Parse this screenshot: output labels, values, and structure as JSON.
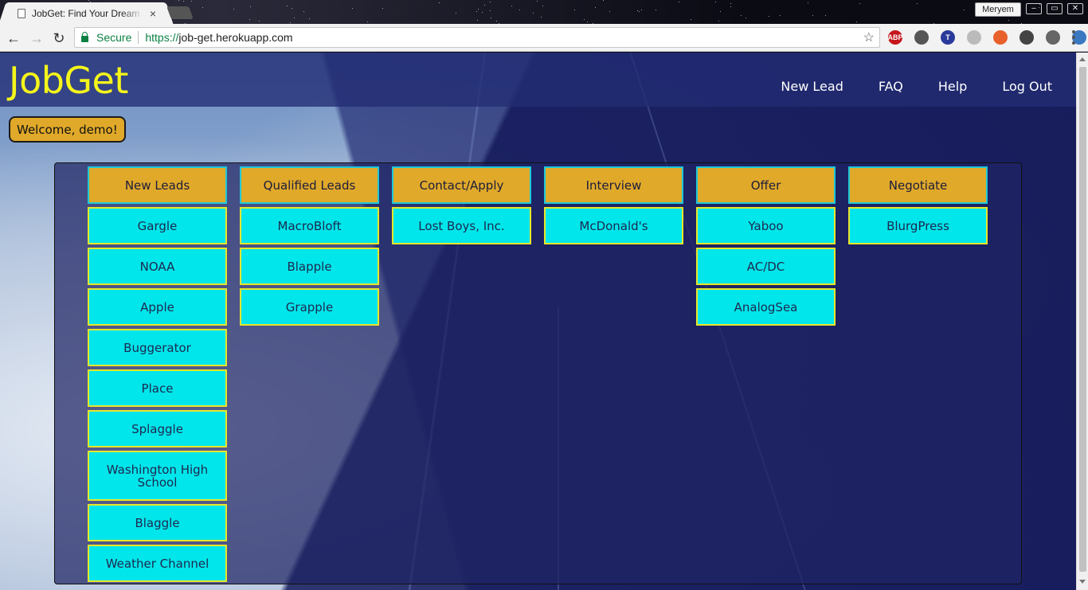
{
  "browser": {
    "tab_title": "JobGet: Find Your Dream Job",
    "tab_close": "×",
    "profile_name": "Meryem",
    "secure_label": "Secure",
    "url_scheme": "https://",
    "url_host": "job-get.herokuapp.com",
    "icons": {
      "back": "arrow-left-icon",
      "forward": "arrow-right-icon",
      "reload": "reload-icon",
      "bookmark": "star-icon",
      "menu": "menu-dots-icon"
    },
    "extensions": [
      {
        "name": "adblock-icon",
        "label": "ABP",
        "color": "#c4161c"
      },
      {
        "name": "pen-extension-icon",
        "label": "",
        "color": "#555555"
      },
      {
        "name": "t-extension-icon",
        "label": "T",
        "color": "#2a3a9a"
      },
      {
        "name": "circle-extension-icon",
        "label": "",
        "color": "#bbbbbb"
      },
      {
        "name": "orange-extension-icon",
        "label": "",
        "color": "#e8602c"
      },
      {
        "name": "react-extension-icon",
        "label": "",
        "color": "#444444"
      },
      {
        "name": "gear-extension-icon",
        "label": "",
        "color": "#666666"
      },
      {
        "name": "owl-extension-icon",
        "label": "",
        "color": "#3b78c2"
      }
    ]
  },
  "navbar": {
    "brand": "JobGet",
    "links": [
      "New Lead",
      "FAQ",
      "Help",
      "Log Out"
    ]
  },
  "welcome": "Welcome, demo!",
  "board": {
    "columns": [
      {
        "title": "New Leads",
        "cards": [
          "Gargle",
          "NOAA",
          "Apple",
          "Buggerator",
          "Place",
          "Splaggle",
          "Washington High School",
          "Blaggle",
          "Weather Channel"
        ]
      },
      {
        "title": "Qualified Leads",
        "cards": [
          "MacroBloft",
          "Blapple",
          "Grapple"
        ]
      },
      {
        "title": "Contact/Apply",
        "cards": [
          "Lost Boys, Inc."
        ]
      },
      {
        "title": "Interview",
        "cards": [
          "McDonald's"
        ]
      },
      {
        "title": "Offer",
        "cards": [
          "Yaboo",
          "AC/DC",
          "AnalogSea"
        ]
      },
      {
        "title": "Negotiate",
        "cards": [
          "BlurgPress"
        ]
      }
    ]
  },
  "colors": {
    "brand": "#f5f51a",
    "header_bg": "#e0a92a",
    "header_border": "#1ec8d8",
    "card_bg": "#00e6ea",
    "card_border": "#e9e62a"
  }
}
